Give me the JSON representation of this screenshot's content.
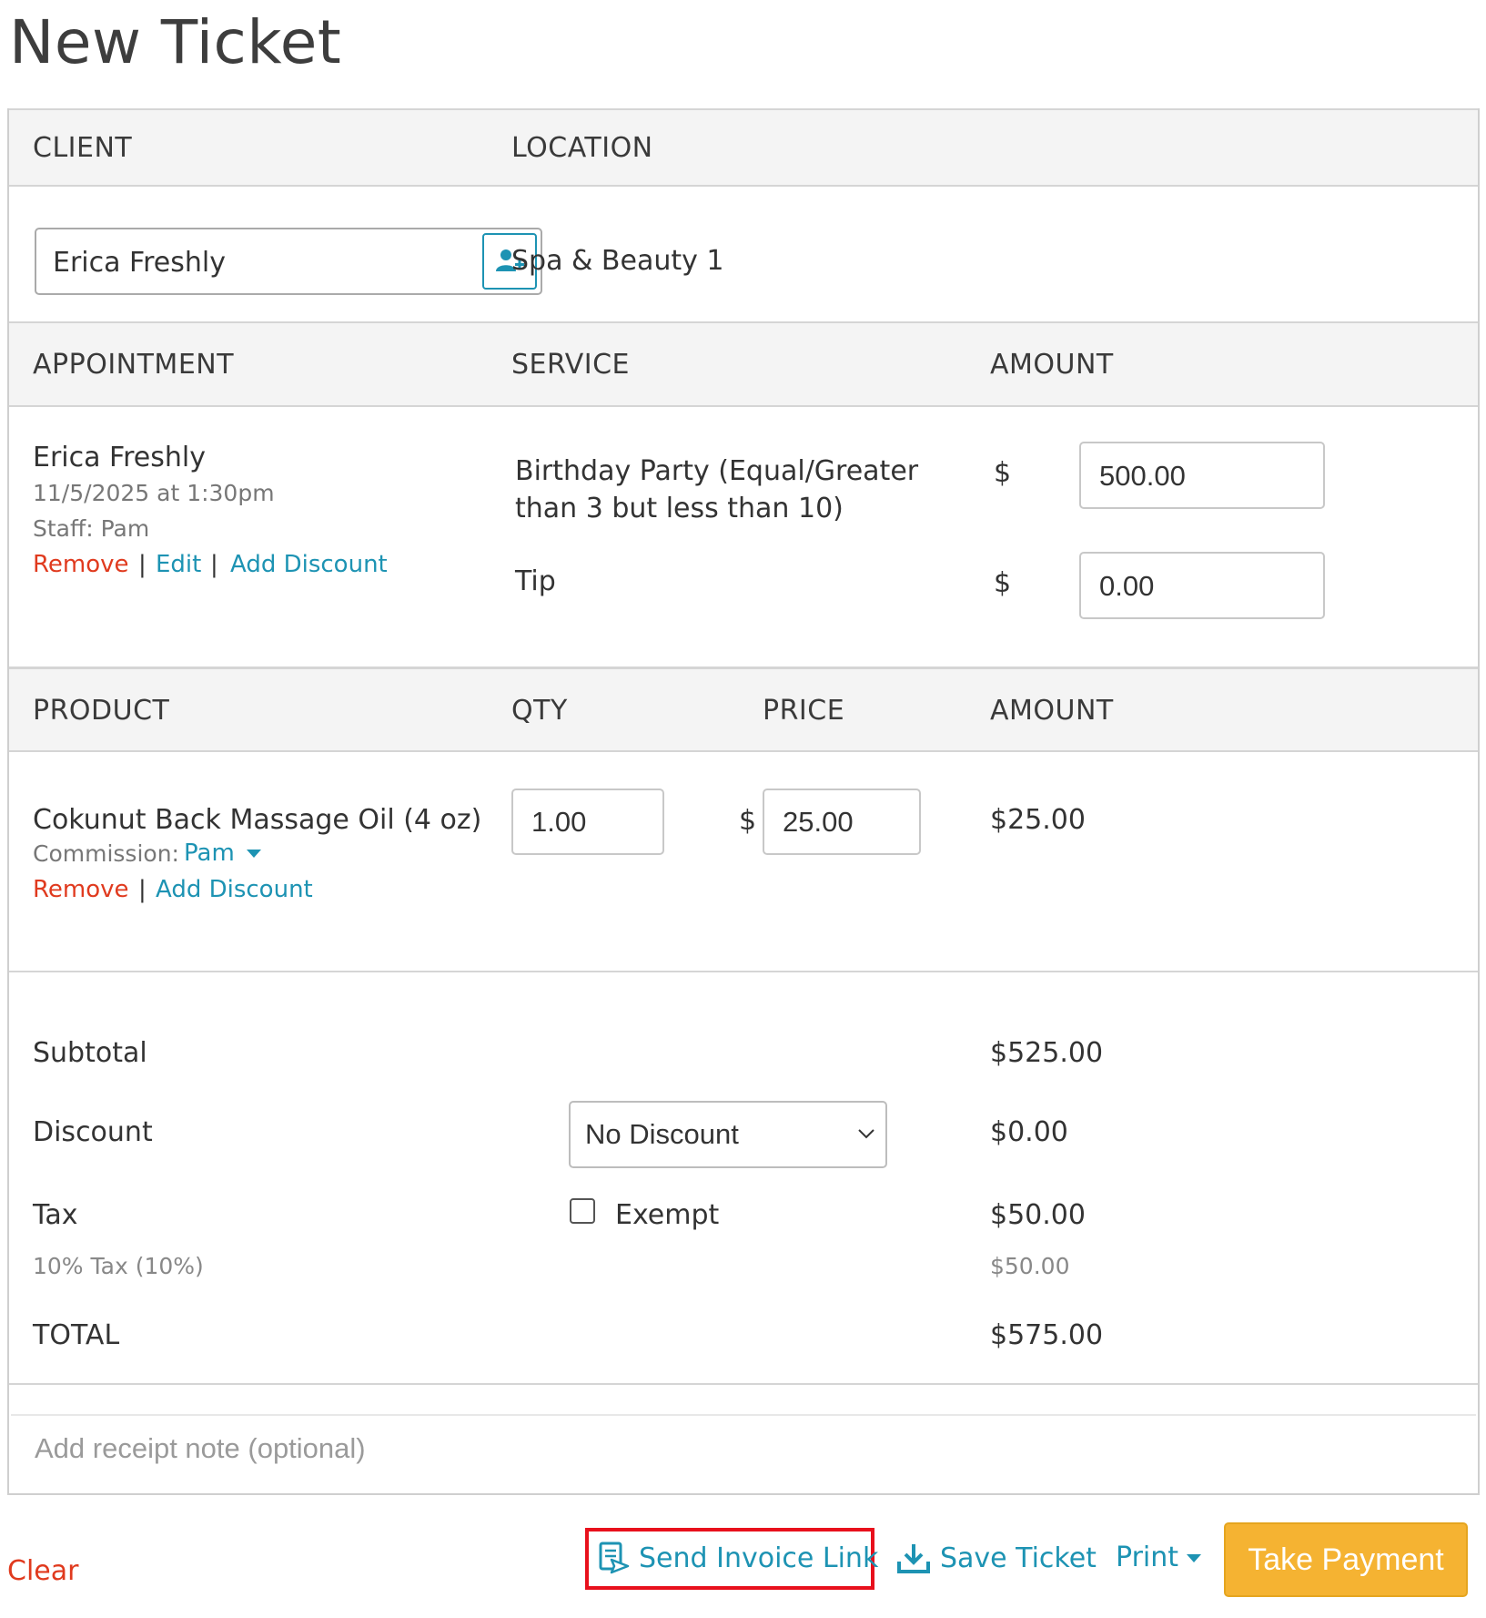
{
  "page": {
    "title": "New Ticket"
  },
  "client_section": {
    "client_header": "CLIENT",
    "location_header": "LOCATION",
    "client_name": "Erica Freshly",
    "location_value": "Spa & Beauty 1"
  },
  "appointment_section": {
    "headers": {
      "appointment": "APPOINTMENT",
      "service": "SERVICE",
      "amount": "AMOUNT"
    },
    "client_name": "Erica Freshly",
    "datetime": "11/5/2025 at 1:30pm",
    "staff": "Staff: Pam",
    "remove": "Remove",
    "edit": "Edit",
    "add_discount": "Add Discount",
    "separator": "|",
    "service_line1": "Birthday Party (Equal/Greater",
    "service_line2": "than 3 but less than 10)",
    "service_amount": "500.00",
    "tip_label": "Tip",
    "tip_amount": "0.00",
    "currency": "$"
  },
  "product_section": {
    "headers": {
      "product": "PRODUCT",
      "qty": "QTY",
      "price": "PRICE",
      "amount": "AMOUNT"
    },
    "product_name": "Cokunut Back Massage Oil (4 oz)",
    "commission_label": "Commission:",
    "commission_staff": "Pam",
    "remove": "Remove",
    "add_discount": "Add Discount",
    "separator": "|",
    "qty": "1.00",
    "currency": "$",
    "price": "25.00",
    "amount": "$25.00"
  },
  "totals": {
    "subtotal_label": "Subtotal",
    "subtotal_value": "$525.00",
    "discount_label": "Discount",
    "discount_selected": "No Discount",
    "discount_value": "$0.00",
    "tax_label": "Tax",
    "exempt_label": "Exempt",
    "tax_value": "$50.00",
    "tax_detail_label": "10% Tax (10%)",
    "tax_detail_value": "$50.00",
    "total_label": "TOTAL",
    "total_value": "$575.00"
  },
  "receipt_note": {
    "placeholder": "Add receipt note (optional)"
  },
  "footer": {
    "clear": "Clear",
    "send_invoice_link": "Send Invoice Link",
    "save_ticket": "Save Ticket",
    "print": "Print",
    "take_payment": "Take Payment"
  },
  "colors": {
    "link": "#1d93b3",
    "danger": "#e03a1e",
    "primary_button": "#f5b332",
    "highlight_box": "#e8101c"
  }
}
